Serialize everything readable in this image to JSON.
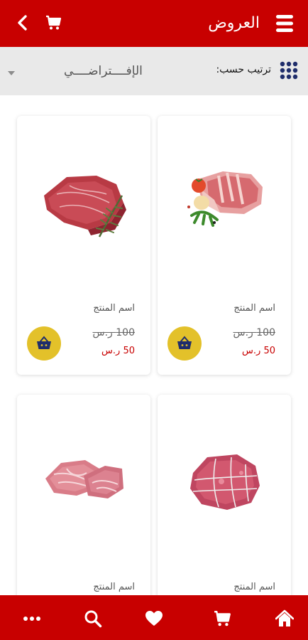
{
  "header": {
    "title": "العروض",
    "back_icon": "chevron-left-icon",
    "cart_icon": "cart-icon",
    "menu_icon": "menu-lines-icon"
  },
  "sort": {
    "label": "ترتيب حسب:",
    "value": "الإفــــتراضــــي",
    "icon": "grid-dots-icon"
  },
  "products": [
    {
      "name": "اسم المنتج",
      "old_price": "100 ر.س",
      "new_price": "50 ر.س"
    },
    {
      "name": "اسم المنتج",
      "old_price": "100 ر.س",
      "new_price": "50 ر.س"
    },
    {
      "name": "اسم المنتج"
    },
    {
      "name": "اسم المنتج"
    }
  ],
  "bottom_nav": [
    "home-icon",
    "cart-icon",
    "heart-icon",
    "search-icon",
    "more-dots-icon"
  ],
  "colors": {
    "primary": "#c80000",
    "sort_bar": "#e9e9e9",
    "basket": "#e3c12a",
    "price_red": "#c80000"
  }
}
